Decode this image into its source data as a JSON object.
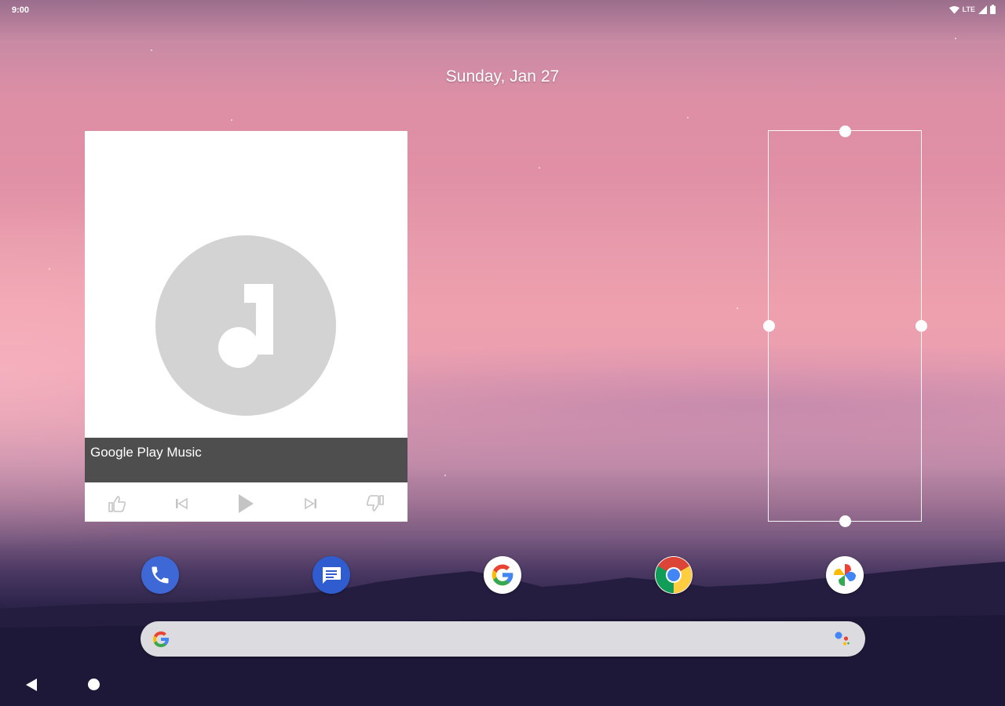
{
  "status_bar": {
    "time": "9:00",
    "network_label": "LTE",
    "icons": [
      "wifi-icon",
      "signal-icon",
      "battery-icon"
    ]
  },
  "home": {
    "date": "Sunday, Jan 27"
  },
  "music_widget": {
    "track_title": "Google Play Music",
    "controls": [
      "thumbs-up-icon",
      "skip-previous-icon",
      "play-icon",
      "skip-next-icon",
      "thumbs-down-icon"
    ]
  },
  "dock": {
    "apps": [
      "Phone",
      "Messages",
      "Google",
      "Chrome",
      "Photos"
    ]
  },
  "search_bar": {
    "icons": [
      "google-g-icon",
      "assistant-icon"
    ]
  },
  "navigation": {
    "buttons": [
      "back-icon",
      "home-icon"
    ]
  },
  "colors": {
    "phone": "#3d68d6",
    "messages": "#2f5dd0",
    "widget_bar": "#4e4e4e",
    "album_art": "#d3d3d3",
    "google_blue": "#4285F4",
    "google_red": "#EA4335",
    "google_yellow": "#FBBC05",
    "google_green": "#34A853"
  }
}
